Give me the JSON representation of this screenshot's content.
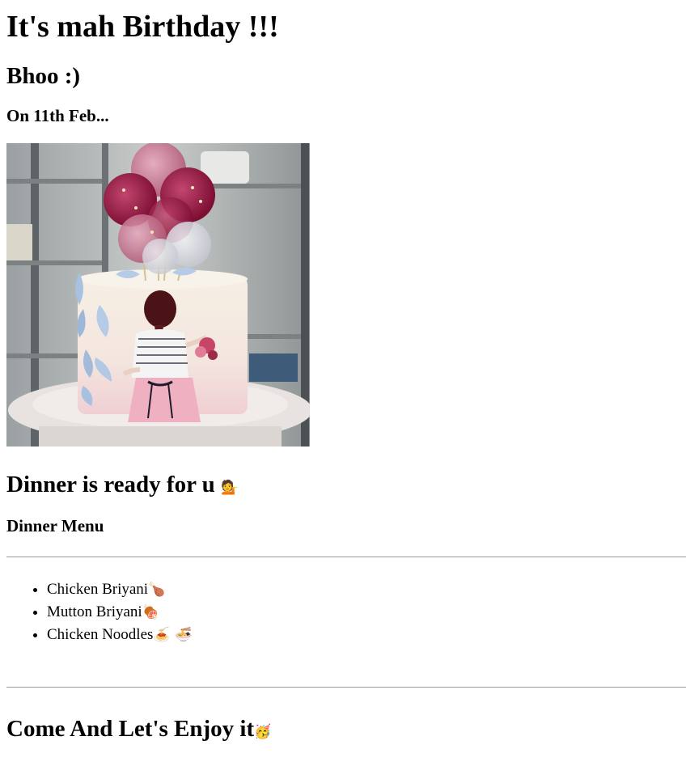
{
  "page": {
    "title": "It's mah Birthday !!!",
    "subtitle": "Bhoo :)",
    "date_line": "On 11th Feb...",
    "image_alt": "Cake with balloons and a girl illustration",
    "dinner_heading": "Dinner is ready for u",
    "dinner_heading_emoji": "💁",
    "menu_heading": "Dinner Menu",
    "menu_items": [
      {
        "name": "Chicken Briyani",
        "emoji": "🍗"
      },
      {
        "name": "Mutton Briyani",
        "emoji": "🍖"
      },
      {
        "name": "Chicken Noodles",
        "emoji": "🍝 🍜"
      }
    ],
    "closing": "Come And Let's Enjoy it",
    "closing_emoji": "🥳"
  }
}
